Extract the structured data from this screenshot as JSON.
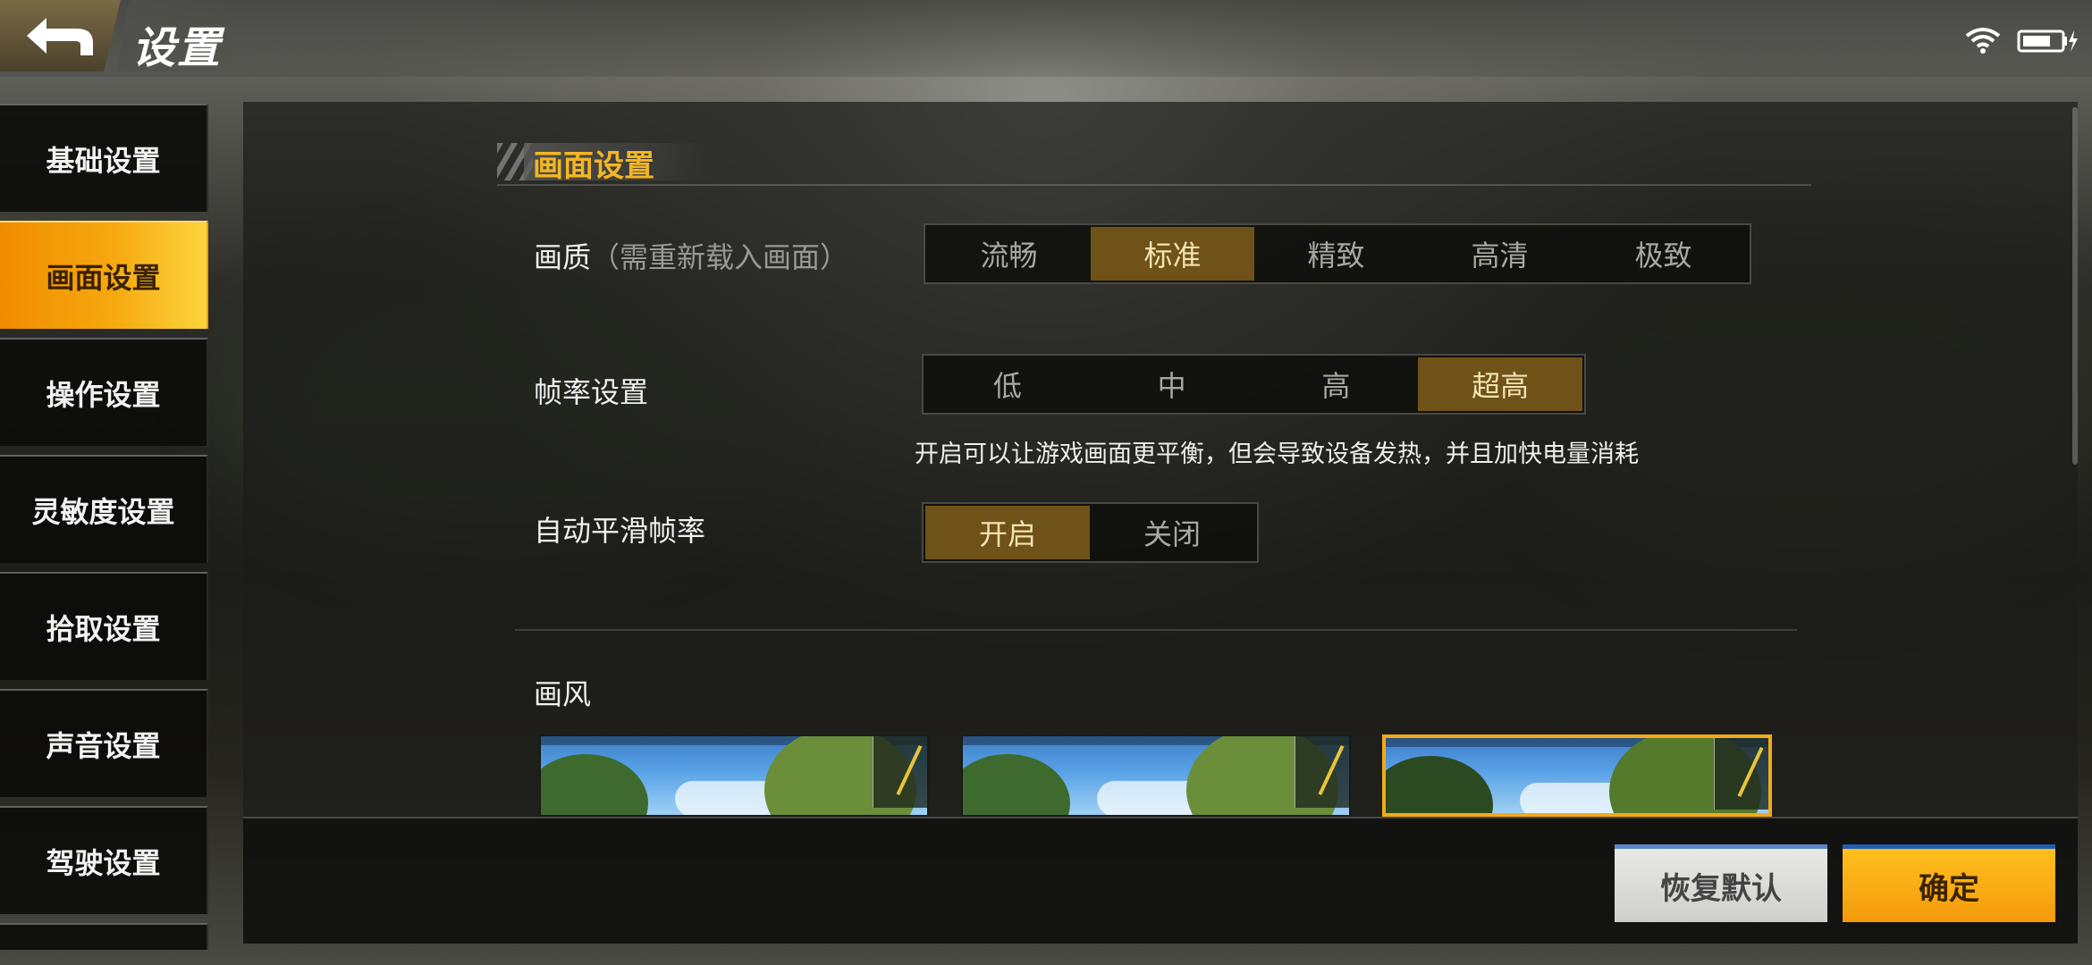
{
  "header": {
    "title": "设置"
  },
  "sidebar": {
    "items": [
      {
        "label": "基础设置"
      },
      {
        "label": "画面设置"
      },
      {
        "label": "操作设置"
      },
      {
        "label": "灵敏度设置"
      },
      {
        "label": "拾取设置"
      },
      {
        "label": "声音设置"
      },
      {
        "label": "驾驶设置"
      }
    ],
    "active": "画面设置"
  },
  "section": {
    "title": "画面设置"
  },
  "quality": {
    "label": "画质",
    "hint": "（需重新载入画面）",
    "options": [
      "流畅",
      "标准",
      "精致",
      "高清",
      "极致"
    ],
    "selected": "标准"
  },
  "framerate": {
    "label": "帧率设置",
    "options": [
      "低",
      "中",
      "高",
      "超高"
    ],
    "selected": "超高",
    "note": "开启可以让游戏画面更平衡，但会导致设备发热，并且加快电量消耗"
  },
  "smooth_frame": {
    "label": "自动平滑帧率",
    "options": [
      "开启",
      "关闭"
    ],
    "selected": "开启"
  },
  "style": {
    "label": "画风",
    "thumbnails": 3,
    "selected_index": 2
  },
  "footer": {
    "reset_label": "恢复默认",
    "confirm_label": "确定"
  },
  "status": {
    "wifi_icon": "wifi-icon",
    "battery_icon": "battery-charging-icon"
  },
  "colors": {
    "accent": "#f4b623",
    "active_tab": "#f6a90f",
    "selected_option": "#6f5217"
  }
}
